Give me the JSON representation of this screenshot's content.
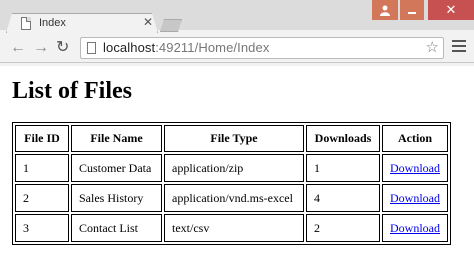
{
  "browser": {
    "tab_title": "Index",
    "url_host": "localhost",
    "url_path": ":49211/Home/Index"
  },
  "page": {
    "title": "List of Files"
  },
  "table": {
    "headers": [
      "File ID",
      "File Name",
      "File Type",
      "Downloads",
      "Action"
    ],
    "rows": [
      {
        "id": "1",
        "name": "Customer Data",
        "type": "application/zip",
        "downloads": "1",
        "action": "Download"
      },
      {
        "id": "2",
        "name": "Sales History",
        "type": "application/vnd.ms-excel",
        "downloads": "4",
        "action": "Download"
      },
      {
        "id": "3",
        "name": "Contact List",
        "type": "text/csv",
        "downloads": "2",
        "action": "Download"
      }
    ]
  },
  "colors": {
    "link": "#0000ee",
    "window_controls": "#d2775a",
    "close_button": "#c75050"
  }
}
